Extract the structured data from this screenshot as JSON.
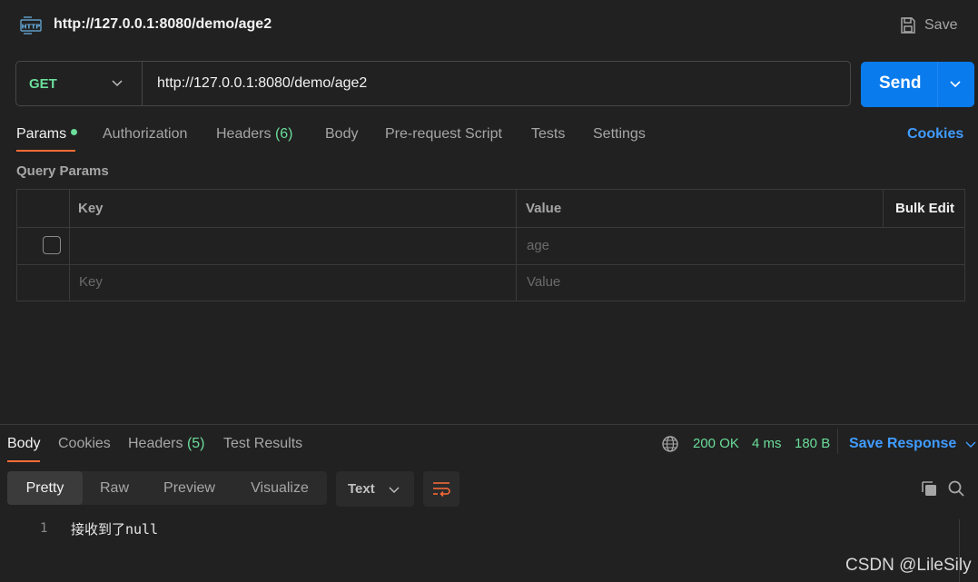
{
  "header": {
    "title": "http://127.0.0.1:8080/demo/age2",
    "save_label": "Save"
  },
  "request": {
    "method": "GET",
    "url": "http://127.0.0.1:8080/demo/age2",
    "send_label": "Send"
  },
  "tabs": {
    "params": "Params",
    "authorization": "Authorization",
    "headers": "Headers",
    "headers_count": "(6)",
    "body": "Body",
    "pre_request": "Pre-request Script",
    "tests": "Tests",
    "settings": "Settings",
    "cookies": "Cookies"
  },
  "query_params": {
    "title": "Query Params",
    "col_key": "Key",
    "col_value": "Value",
    "bulk_edit": "Bulk Edit",
    "row1_value_placeholder": "age",
    "new_key_placeholder": "Key",
    "new_value_placeholder": "Value"
  },
  "response": {
    "tabs": {
      "body": "Body",
      "cookies": "Cookies",
      "headers": "Headers",
      "headers_count": "(5)",
      "test_results": "Test Results"
    },
    "status": "200 OK",
    "time": "4 ms",
    "size": "180 B",
    "save_response": "Save Response",
    "view_modes": [
      "Pretty",
      "Raw",
      "Preview",
      "Visualize"
    ],
    "format": "Text",
    "line_number": "1",
    "body_text": "接收到了null"
  },
  "watermark": "CSDN @LileSily",
  "colors": {
    "accent_orange": "#ff6c37",
    "send_blue": "#097bed",
    "link_blue": "#409cff",
    "success_green": "#6bdd9a"
  }
}
